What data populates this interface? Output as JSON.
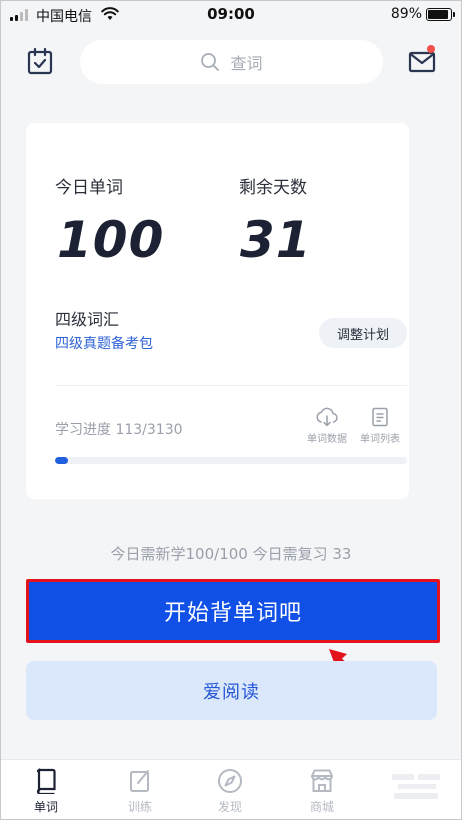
{
  "status_bar": {
    "carrier": "中国电信",
    "time": "09:00",
    "battery": "89%"
  },
  "header": {
    "search_placeholder": "查词",
    "has_unread": true
  },
  "card": {
    "today_words_label": "今日单词",
    "today_words_value": "100",
    "days_left_label": "剩余天数",
    "days_left_value": "31",
    "book_title": "四级词汇",
    "book_subtitle": "四级真题备考包",
    "adjust_plan": "调整计划",
    "progress_label": "学习进度 113/3130",
    "progress_fraction": 0.036,
    "tools": [
      {
        "icon": "cloud-download-icon",
        "label": "单词数据"
      },
      {
        "icon": "document-list-icon",
        "label": "单词列表"
      }
    ]
  },
  "daily_summary": "今日需新学100/100  今日需复习 33",
  "start_button": "开始背单词吧",
  "read_button": "爱阅读",
  "tabs": [
    {
      "label": "单词",
      "icon": "book-icon",
      "active": true
    },
    {
      "label": "训练",
      "icon": "edit-icon",
      "active": false
    },
    {
      "label": "发现",
      "icon": "compass-icon",
      "active": false
    },
    {
      "label": "商城",
      "icon": "store-icon",
      "active": false
    }
  ],
  "colors": {
    "primary": "#1150e6",
    "highlight_border": "#e3121c",
    "link_blue": "#2f63d6",
    "light_button": "#dbe7fb"
  }
}
